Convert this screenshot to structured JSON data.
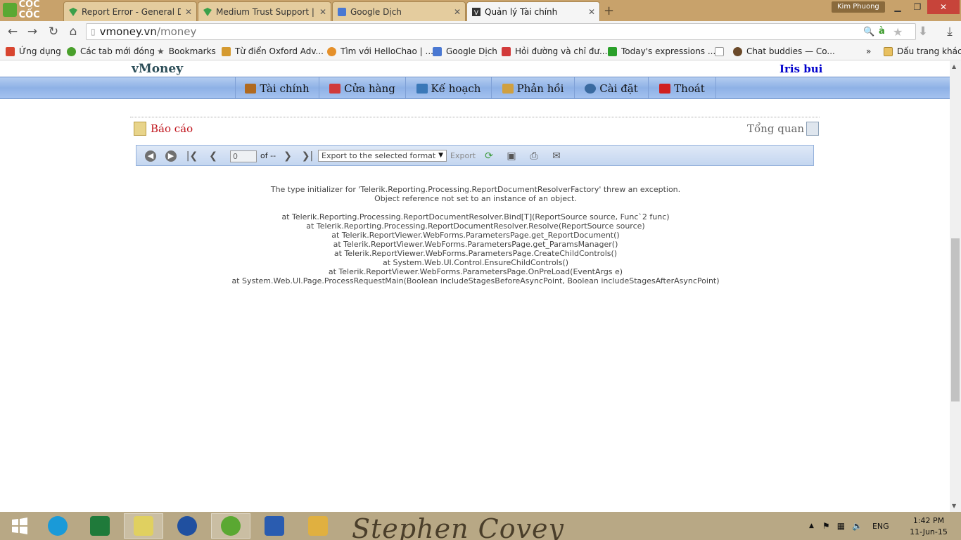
{
  "browser": {
    "brand": "CỐC CỐC",
    "tabs": [
      {
        "label": "Report Error - General Disc",
        "icon": "telerik-icon"
      },
      {
        "label": "Medium Trust Support | Re",
        "icon": "telerik-icon"
      },
      {
        "label": "Google Dịch",
        "icon": "google-translate-icon"
      },
      {
        "label": "Quản lý Tài chính",
        "icon": "vmoney-icon"
      }
    ],
    "new_tab_label": "+",
    "user_chip": "Kim Phuong",
    "url_host": "vmoney.vn",
    "url_path": "/money",
    "bookmarks": [
      {
        "label": "Ứng dụng",
        "color": "#d8452f"
      },
      {
        "label": "Các tab mới đóng",
        "color": "#4aa02c"
      },
      {
        "label": "Bookmarks",
        "color": "#555555"
      },
      {
        "label": "Từ điển Oxford Adv...",
        "color": "#d59a30"
      },
      {
        "label": "Tìm với HelloChao | ...",
        "color": "#e5902a"
      },
      {
        "label": "Google Dịch",
        "color": "#4a78d2"
      },
      {
        "label": "Hỏi đường và chỉ đư...",
        "color": "#d23a3a"
      },
      {
        "label": "Today's expressions ...",
        "color": "#2aa02a"
      },
      {
        "label": "",
        "color": "#ffffff"
      },
      {
        "label": "Chat buddies — Co...",
        "color": "#6b4a2a"
      }
    ],
    "bookmarks_more": "»",
    "other_bookmarks": "Dấu trang khác"
  },
  "site": {
    "logo": "vMoney",
    "username": "Iris bui",
    "menu": [
      {
        "label": "Tài chính",
        "color": "#b06a20"
      },
      {
        "label": "Cửa hàng",
        "color": "#d03a3a"
      },
      {
        "label": "Kế hoạch",
        "color": "#3a78b8"
      },
      {
        "label": "Phản hồi",
        "color": "#d0a040"
      },
      {
        "label": "Cài đặt",
        "color": "#3a6aa0"
      },
      {
        "label": "Thoát",
        "color": "#d02020"
      }
    ],
    "report_title": "Báo cáo",
    "overview": "Tổng quan"
  },
  "report_viewer": {
    "page_value": "0",
    "of_label": "of --",
    "export_select": "Export to the selected format",
    "export_label": "Export"
  },
  "error": {
    "lines_1": [
      "The type initializer for 'Telerik.Reporting.Processing.ReportDocumentResolverFactory' threw an exception.",
      "Object reference not set to an instance of an object."
    ],
    "lines_2": [
      "at Telerik.Reporting.Processing.ReportDocumentResolver.Bind[T](ReportSource source, Func`2 func)",
      "at Telerik.Reporting.Processing.ReportDocumentResolver.Resolve(ReportSource source)",
      "at Telerik.ReportViewer.WebForms.ParametersPage.get_ReportDocument()",
      "at Telerik.ReportViewer.WebForms.ParametersPage.get_ParamsManager()",
      "at Telerik.ReportViewer.WebForms.ParametersPage.CreateChildControls()",
      "at System.Web.UI.Control.EnsureChildControls()",
      "at Telerik.ReportViewer.WebForms.ParametersPage.OnPreLoad(EventArgs e)",
      "at System.Web.UI.Page.ProcessRequestMain(Boolean includeStagesBeforeAsyncPoint, Boolean includeStagesAfterAsyncPoint)"
    ]
  },
  "taskbar": {
    "wallpaper_text": "Stephen Covey",
    "lang": "ENG",
    "time": "1:42 PM",
    "date": "11-Jun-15",
    "apps": [
      {
        "name": "start-button",
        "color": "#ffffff"
      },
      {
        "name": "skype-app",
        "color": "#1a9ad8"
      },
      {
        "name": "excel-app",
        "color": "#1f7a3a"
      },
      {
        "name": "sticky-notes-app",
        "color": "#e0d060"
      },
      {
        "name": "media-app",
        "color": "#2050a0"
      },
      {
        "name": "coccoc-app",
        "color": "#5aa832"
      },
      {
        "name": "word-app",
        "color": "#2a5cb0"
      },
      {
        "name": "explorer-app",
        "color": "#e0b040"
      }
    ]
  }
}
